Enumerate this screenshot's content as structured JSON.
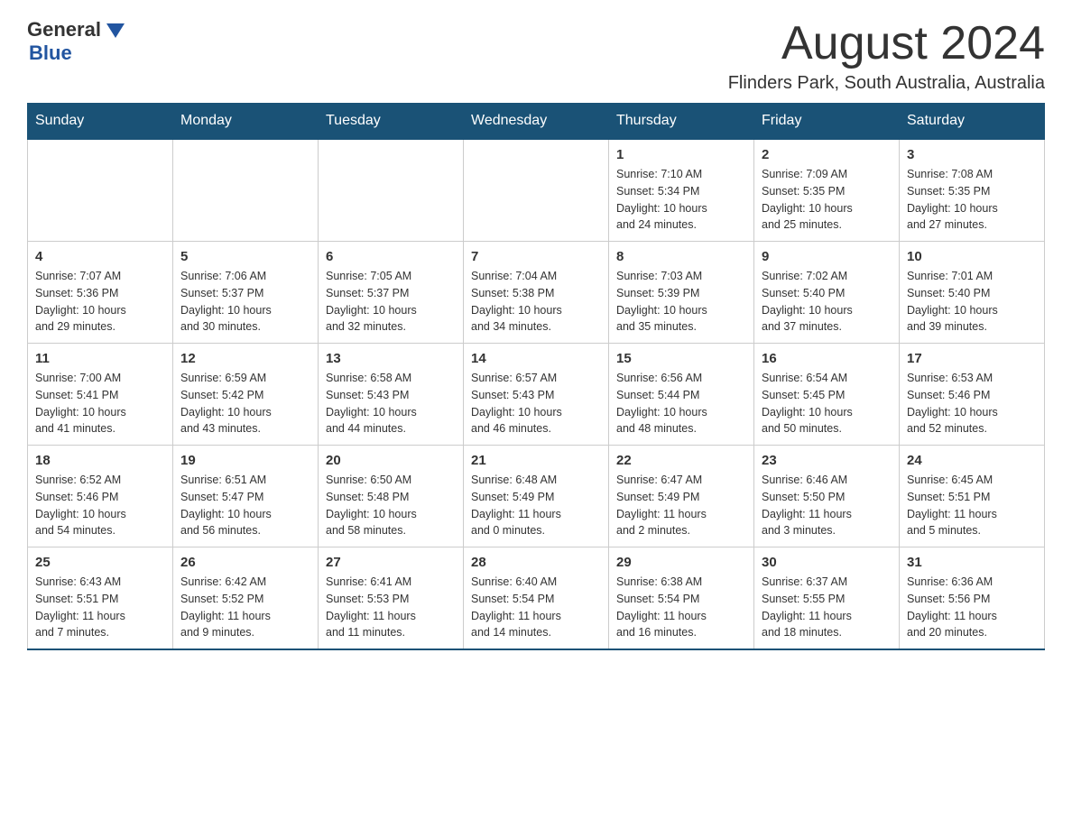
{
  "header": {
    "logo_general": "General",
    "logo_blue": "Blue",
    "month_title": "August 2024",
    "location": "Flinders Park, South Australia, Australia"
  },
  "weekdays": [
    "Sunday",
    "Monday",
    "Tuesday",
    "Wednesday",
    "Thursday",
    "Friday",
    "Saturday"
  ],
  "weeks": [
    [
      {
        "day": "",
        "info": ""
      },
      {
        "day": "",
        "info": ""
      },
      {
        "day": "",
        "info": ""
      },
      {
        "day": "",
        "info": ""
      },
      {
        "day": "1",
        "info": "Sunrise: 7:10 AM\nSunset: 5:34 PM\nDaylight: 10 hours\nand 24 minutes."
      },
      {
        "day": "2",
        "info": "Sunrise: 7:09 AM\nSunset: 5:35 PM\nDaylight: 10 hours\nand 25 minutes."
      },
      {
        "day": "3",
        "info": "Sunrise: 7:08 AM\nSunset: 5:35 PM\nDaylight: 10 hours\nand 27 minutes."
      }
    ],
    [
      {
        "day": "4",
        "info": "Sunrise: 7:07 AM\nSunset: 5:36 PM\nDaylight: 10 hours\nand 29 minutes."
      },
      {
        "day": "5",
        "info": "Sunrise: 7:06 AM\nSunset: 5:37 PM\nDaylight: 10 hours\nand 30 minutes."
      },
      {
        "day": "6",
        "info": "Sunrise: 7:05 AM\nSunset: 5:37 PM\nDaylight: 10 hours\nand 32 minutes."
      },
      {
        "day": "7",
        "info": "Sunrise: 7:04 AM\nSunset: 5:38 PM\nDaylight: 10 hours\nand 34 minutes."
      },
      {
        "day": "8",
        "info": "Sunrise: 7:03 AM\nSunset: 5:39 PM\nDaylight: 10 hours\nand 35 minutes."
      },
      {
        "day": "9",
        "info": "Sunrise: 7:02 AM\nSunset: 5:40 PM\nDaylight: 10 hours\nand 37 minutes."
      },
      {
        "day": "10",
        "info": "Sunrise: 7:01 AM\nSunset: 5:40 PM\nDaylight: 10 hours\nand 39 minutes."
      }
    ],
    [
      {
        "day": "11",
        "info": "Sunrise: 7:00 AM\nSunset: 5:41 PM\nDaylight: 10 hours\nand 41 minutes."
      },
      {
        "day": "12",
        "info": "Sunrise: 6:59 AM\nSunset: 5:42 PM\nDaylight: 10 hours\nand 43 minutes."
      },
      {
        "day": "13",
        "info": "Sunrise: 6:58 AM\nSunset: 5:43 PM\nDaylight: 10 hours\nand 44 minutes."
      },
      {
        "day": "14",
        "info": "Sunrise: 6:57 AM\nSunset: 5:43 PM\nDaylight: 10 hours\nand 46 minutes."
      },
      {
        "day": "15",
        "info": "Sunrise: 6:56 AM\nSunset: 5:44 PM\nDaylight: 10 hours\nand 48 minutes."
      },
      {
        "day": "16",
        "info": "Sunrise: 6:54 AM\nSunset: 5:45 PM\nDaylight: 10 hours\nand 50 minutes."
      },
      {
        "day": "17",
        "info": "Sunrise: 6:53 AM\nSunset: 5:46 PM\nDaylight: 10 hours\nand 52 minutes."
      }
    ],
    [
      {
        "day": "18",
        "info": "Sunrise: 6:52 AM\nSunset: 5:46 PM\nDaylight: 10 hours\nand 54 minutes."
      },
      {
        "day": "19",
        "info": "Sunrise: 6:51 AM\nSunset: 5:47 PM\nDaylight: 10 hours\nand 56 minutes."
      },
      {
        "day": "20",
        "info": "Sunrise: 6:50 AM\nSunset: 5:48 PM\nDaylight: 10 hours\nand 58 minutes."
      },
      {
        "day": "21",
        "info": "Sunrise: 6:48 AM\nSunset: 5:49 PM\nDaylight: 11 hours\nand 0 minutes."
      },
      {
        "day": "22",
        "info": "Sunrise: 6:47 AM\nSunset: 5:49 PM\nDaylight: 11 hours\nand 2 minutes."
      },
      {
        "day": "23",
        "info": "Sunrise: 6:46 AM\nSunset: 5:50 PM\nDaylight: 11 hours\nand 3 minutes."
      },
      {
        "day": "24",
        "info": "Sunrise: 6:45 AM\nSunset: 5:51 PM\nDaylight: 11 hours\nand 5 minutes."
      }
    ],
    [
      {
        "day": "25",
        "info": "Sunrise: 6:43 AM\nSunset: 5:51 PM\nDaylight: 11 hours\nand 7 minutes."
      },
      {
        "day": "26",
        "info": "Sunrise: 6:42 AM\nSunset: 5:52 PM\nDaylight: 11 hours\nand 9 minutes."
      },
      {
        "day": "27",
        "info": "Sunrise: 6:41 AM\nSunset: 5:53 PM\nDaylight: 11 hours\nand 11 minutes."
      },
      {
        "day": "28",
        "info": "Sunrise: 6:40 AM\nSunset: 5:54 PM\nDaylight: 11 hours\nand 14 minutes."
      },
      {
        "day": "29",
        "info": "Sunrise: 6:38 AM\nSunset: 5:54 PM\nDaylight: 11 hours\nand 16 minutes."
      },
      {
        "day": "30",
        "info": "Sunrise: 6:37 AM\nSunset: 5:55 PM\nDaylight: 11 hours\nand 18 minutes."
      },
      {
        "day": "31",
        "info": "Sunrise: 6:36 AM\nSunset: 5:56 PM\nDaylight: 11 hours\nand 20 minutes."
      }
    ]
  ]
}
